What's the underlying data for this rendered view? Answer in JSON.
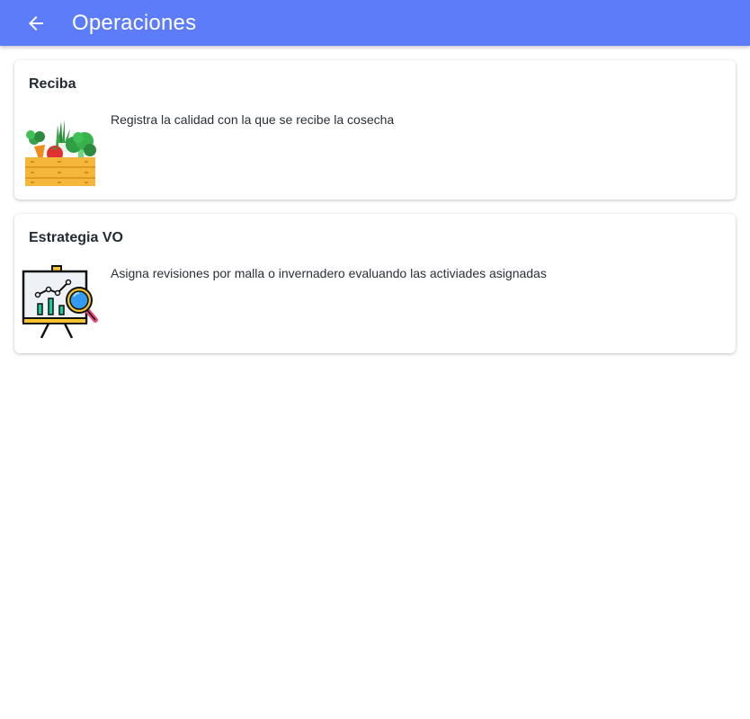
{
  "header": {
    "title": "Operaciones",
    "back_icon": "arrow-left-icon",
    "background": "#5c7cfa"
  },
  "cards": [
    {
      "title": "Reciba",
      "description": "Registra la calidad con la que se recibe la cosecha",
      "image_icon": "vegetable-crate-icon"
    },
    {
      "title": "Estrategia VO",
      "description": "Asigna revisiones por malla o invernadero evaluando las activiades asignadas",
      "image_icon": "analytics-board-icon"
    }
  ]
}
